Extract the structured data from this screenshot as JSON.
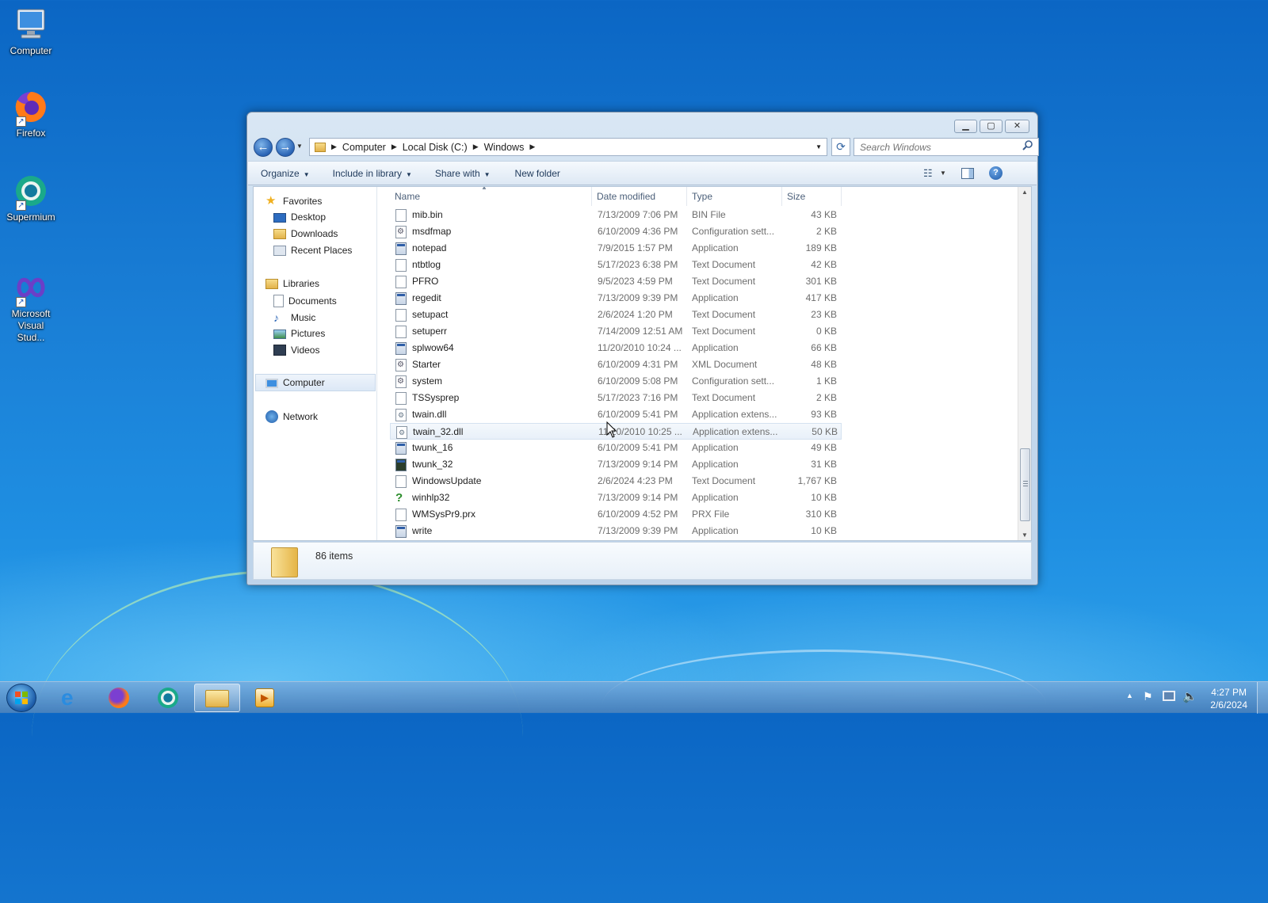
{
  "desktop": {
    "icons": [
      {
        "label": "Computer"
      },
      {
        "label": "Firefox"
      },
      {
        "label": "Supermium"
      },
      {
        "label": "Microsoft Visual Stud..."
      }
    ]
  },
  "window": {
    "breadcrumb": [
      "Computer",
      "Local Disk (C:)",
      "Windows"
    ],
    "search_placeholder": "Search Windows",
    "toolbar": {
      "organize": "Organize",
      "include_in_library": "Include in library",
      "share_with": "Share with",
      "new_folder": "New folder"
    },
    "nav": {
      "favorites": "Favorites",
      "desktop": "Desktop",
      "downloads": "Downloads",
      "recent_places": "Recent Places",
      "libraries": "Libraries",
      "documents": "Documents",
      "music": "Music",
      "pictures": "Pictures",
      "videos": "Videos",
      "computer": "Computer",
      "network": "Network"
    },
    "columns": {
      "name": "Name",
      "date": "Date modified",
      "type": "Type",
      "size": "Size"
    },
    "files": [
      {
        "name": "mib.bin",
        "date": "7/13/2009 7:06 PM",
        "type": "BIN File",
        "size": "43 KB",
        "icon": "blank"
      },
      {
        "name": "msdfmap",
        "date": "6/10/2009 4:36 PM",
        "type": "Configuration sett...",
        "size": "2 KB",
        "icon": "cfg"
      },
      {
        "name": "notepad",
        "date": "7/9/2015 1:57 PM",
        "type": "Application",
        "size": "189 KB",
        "icon": "app"
      },
      {
        "name": "ntbtlog",
        "date": "5/17/2023 6:38 PM",
        "type": "Text Document",
        "size": "42 KB",
        "icon": "blank"
      },
      {
        "name": "PFRO",
        "date": "9/5/2023 4:59 PM",
        "type": "Text Document",
        "size": "301 KB",
        "icon": "blank"
      },
      {
        "name": "regedit",
        "date": "7/13/2009 9:39 PM",
        "type": "Application",
        "size": "417 KB",
        "icon": "regedit"
      },
      {
        "name": "setupact",
        "date": "2/6/2024 1:20 PM",
        "type": "Text Document",
        "size": "23 KB",
        "icon": "blank"
      },
      {
        "name": "setuperr",
        "date": "7/14/2009 12:51 AM",
        "type": "Text Document",
        "size": "0 KB",
        "icon": "blank"
      },
      {
        "name": "splwow64",
        "date": "11/20/2010 10:24 ...",
        "type": "Application",
        "size": "66 KB",
        "icon": "app"
      },
      {
        "name": "Starter",
        "date": "6/10/2009 4:31 PM",
        "type": "XML Document",
        "size": "48 KB",
        "icon": "cfg"
      },
      {
        "name": "system",
        "date": "6/10/2009 5:08 PM",
        "type": "Configuration sett...",
        "size": "1 KB",
        "icon": "cfg"
      },
      {
        "name": "TSSysprep",
        "date": "5/17/2023 7:16 PM",
        "type": "Text Document",
        "size": "2 KB",
        "icon": "blank"
      },
      {
        "name": "twain.dll",
        "date": "6/10/2009 5:41 PM",
        "type": "Application extens...",
        "size": "93 KB",
        "icon": "dll"
      },
      {
        "name": "twain_32.dll",
        "date": "11/20/2010 10:25 ...",
        "type": "Application extens...",
        "size": "50 KB",
        "icon": "dll"
      },
      {
        "name": "twunk_16",
        "date": "6/10/2009 5:41 PM",
        "type": "Application",
        "size": "49 KB",
        "icon": "app"
      },
      {
        "name": "twunk_32",
        "date": "7/13/2009 9:14 PM",
        "type": "Application",
        "size": "31 KB",
        "icon": "twunk"
      },
      {
        "name": "WindowsUpdate",
        "date": "2/6/2024 4:23 PM",
        "type": "Text Document",
        "size": "1,767 KB",
        "icon": "blank"
      },
      {
        "name": "winhlp32",
        "date": "7/13/2009 9:14 PM",
        "type": "Application",
        "size": "10 KB",
        "icon": "help"
      },
      {
        "name": "WMSysPr9.prx",
        "date": "6/10/2009 4:52 PM",
        "type": "PRX File",
        "size": "310 KB",
        "icon": "blank"
      },
      {
        "name": "write",
        "date": "7/13/2009 9:39 PM",
        "type": "Application",
        "size": "10 KB",
        "icon": "write"
      }
    ],
    "status": {
      "item_count": "86 items"
    }
  },
  "taskbar": {
    "clock_time": "4:27 PM",
    "clock_date": "2/6/2024"
  },
  "colors": {
    "accent": "#2a64b5",
    "desktop": "#1a7fd6"
  }
}
